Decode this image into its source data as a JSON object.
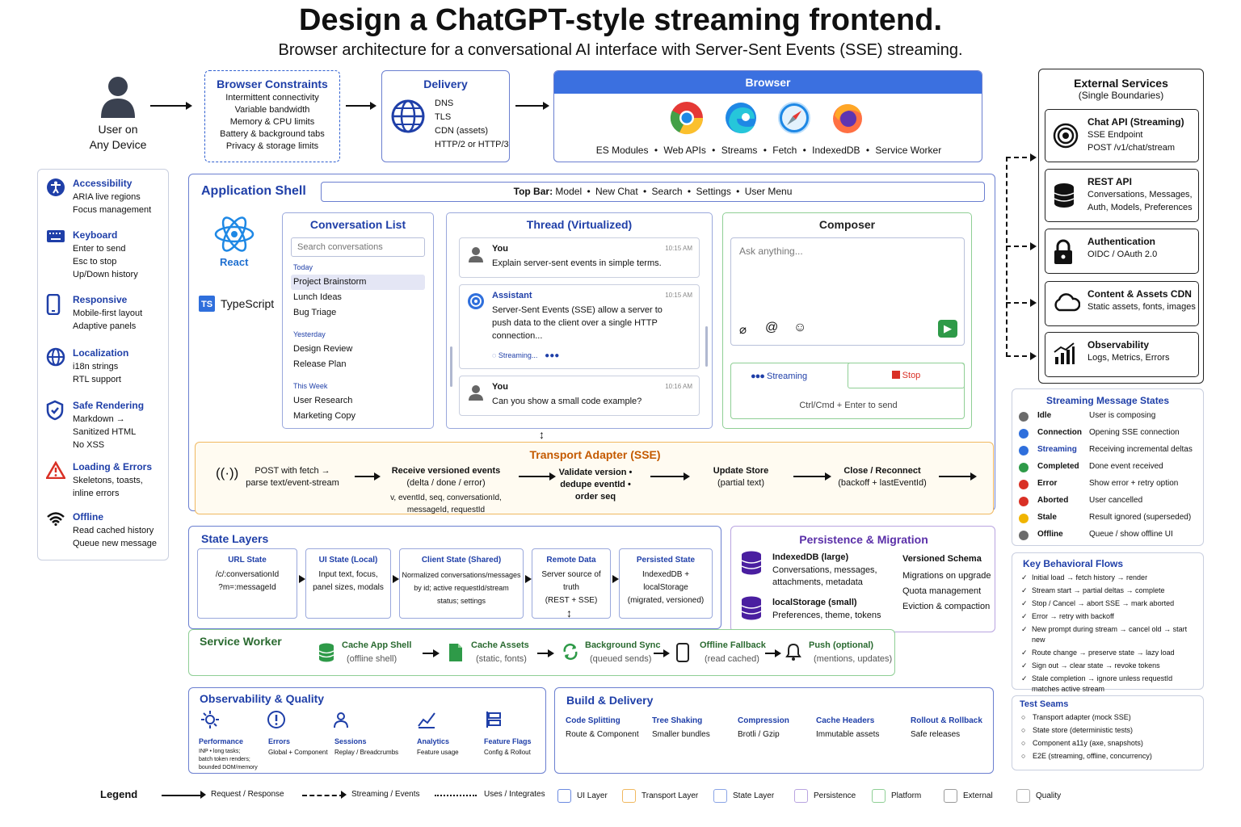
{
  "title": "Design a ChatGPT-style streaming frontend.",
  "subtitle": "Browser architecture for a conversational AI interface with Server-Sent Events (SSE) streaming.",
  "user": {
    "line1": "User on",
    "line2": "Any Device"
  },
  "constraints": {
    "title": "Browser Constraints",
    "items": [
      "Intermittent connectivity",
      "Variable bandwidth",
      "Memory & CPU limits",
      "Battery & background tabs",
      "Privacy & storage limits"
    ]
  },
  "delivery": {
    "title": "Delivery",
    "items": [
      "DNS",
      "TLS",
      "CDN (assets)",
      "HTTP/2 or HTTP/3"
    ]
  },
  "browser": {
    "title": "Browser",
    "features": [
      "ES Modules",
      "Web APIs",
      "Streams",
      "Fetch",
      "IndexedDB",
      "Service Worker"
    ]
  },
  "external": {
    "title": "External Services",
    "subtitle": "(Single Boundaries)",
    "services": [
      {
        "name": "Chat API (Streaming)",
        "lines": [
          "SSE Endpoint",
          "POST /v1/chat/stream"
        ],
        "icon": "sse-icon"
      },
      {
        "name": "REST API",
        "lines": [
          "Conversations, Messages,",
          "Auth, Models, Preferences"
        ],
        "icon": "database-icon"
      },
      {
        "name": "Authentication",
        "lines": [
          "OIDC / OAuth 2.0"
        ],
        "icon": "lock-icon"
      },
      {
        "name": "Content & Assets CDN",
        "lines": [
          "Static assets, fonts, images"
        ],
        "icon": "cloud-icon"
      },
      {
        "name": "Observability",
        "lines": [
          "Logs, Metrics, Errors"
        ],
        "icon": "chart-icon"
      }
    ]
  },
  "sidebar": [
    {
      "title": "Accessibility",
      "lines": [
        "ARIA live regions",
        "Focus management"
      ],
      "icon": "accessibility-icon"
    },
    {
      "title": "Keyboard",
      "lines": [
        "Enter to send",
        "Esc to stop",
        "Up/Down history"
      ],
      "icon": "keyboard-icon"
    },
    {
      "title": "Responsive",
      "lines": [
        "Mobile-first layout",
        "Adaptive panels"
      ],
      "icon": "mobile-icon"
    },
    {
      "title": "Localization",
      "lines": [
        "i18n strings",
        "RTL support"
      ],
      "icon": "globe-icon"
    },
    {
      "title": "Safe Rendering",
      "lines": [
        "Markdown →",
        "Sanitized HTML",
        "No XSS"
      ],
      "icon": "shield-icon"
    },
    {
      "title": "Loading & Errors",
      "lines": [
        "Skeletons, toasts,",
        "inline errors"
      ],
      "icon": "warning-icon"
    },
    {
      "title": "Offline",
      "lines": [
        "Read cached history",
        "Queue new message"
      ],
      "icon": "wifi-icon"
    }
  ],
  "shell": {
    "title": "Application Shell",
    "topbar_label": "Top Bar:",
    "topbar_items": [
      "Model",
      "New Chat",
      "Search",
      "Settings",
      "User Menu"
    ],
    "react": "React",
    "typescript": "TypeScript",
    "ts_badge": "TS"
  },
  "conversations": {
    "title": "Conversation List",
    "search_placeholder": "Search conversations",
    "groups": [
      {
        "label": "Today",
        "items": [
          "Project Brainstorm",
          "Lunch Ideas",
          "Bug Triage"
        ]
      },
      {
        "label": "Yesterday",
        "items": [
          "Design Review",
          "Release Plan"
        ]
      },
      {
        "label": "This Week",
        "items": [
          "User Research",
          "Marketing Copy"
        ]
      }
    ]
  },
  "thread": {
    "title": "Thread (Virtualized)",
    "messages": [
      {
        "author": "You",
        "time": "10:15 AM",
        "text": "Explain server-sent events in simple terms."
      },
      {
        "author": "Assistant",
        "time": "10:15 AM",
        "text": "Server-Sent Events (SSE) allow a server to push data to the client over a single HTTP connection...",
        "status": "Streaming..."
      },
      {
        "author": "You",
        "time": "10:16 AM",
        "text": "Can you show a small code example?"
      }
    ]
  },
  "composer": {
    "title": "Composer",
    "placeholder": "Ask anything...",
    "streaming": "Streaming",
    "stop": "Stop",
    "hint": "Ctrl/Cmd + Enter to send"
  },
  "transport": {
    "title": "Transport Adapter (SSE)",
    "steps": [
      {
        "main": "POST with fetch →",
        "sub": "parse text/event-stream"
      },
      {
        "main": "Receive versioned events",
        "sub": "(delta / done / error)",
        "extra": "v, eventId, seq, conversationId, messageId, requestId"
      },
      {
        "main": "Validate version • dedupe eventId • order seq",
        "sub": ""
      },
      {
        "main": "Update Store",
        "sub": "(partial text)"
      },
      {
        "main": "Close / Reconnect",
        "sub": "(backoff + lastEventId)"
      }
    ]
  },
  "state_layers": {
    "title": "State Layers",
    "items": [
      {
        "name": "URL State",
        "lines": [
          "/c/:conversationId",
          "?m=:messageId"
        ]
      },
      {
        "name": "UI State (Local)",
        "lines": [
          "Input text, focus,",
          "panel sizes, modals"
        ]
      },
      {
        "name": "Client State (Shared)",
        "lines": [
          "Normalized conversations/messages",
          "by id; active requestId/stream",
          "status; settings"
        ]
      },
      {
        "name": "Remote Data",
        "lines": [
          "Server source of truth",
          "(REST + SSE)"
        ]
      },
      {
        "name": "Persisted State",
        "lines": [
          "IndexedDB + localStorage",
          "(migrated, versioned)"
        ]
      }
    ]
  },
  "persistence": {
    "title": "Persistence & Migration",
    "stores": [
      {
        "name": "IndexedDB (large)",
        "lines": [
          "Conversations, messages,",
          "attachments, metadata"
        ]
      },
      {
        "name": "localStorage (small)",
        "lines": [
          "Preferences, theme, tokens"
        ]
      }
    ],
    "schema_title": "Versioned Schema",
    "schema_items": [
      "Migrations on upgrade",
      "Quota management",
      "Eviction & compaction"
    ]
  },
  "service_worker": {
    "title": "Service Worker",
    "steps": [
      {
        "name": "Cache App Shell",
        "sub": "(offline shell)"
      },
      {
        "name": "Cache Assets",
        "sub": "(static, fonts)"
      },
      {
        "name": "Background Sync",
        "sub": "(queued sends)"
      },
      {
        "name": "Offline Fallback",
        "sub": "(read cached)"
      },
      {
        "name": "Push (optional)",
        "sub": "(mentions, updates)"
      }
    ]
  },
  "observability": {
    "title": "Observability & Quality",
    "items": [
      {
        "name": "Performance",
        "lines": [
          "INP • long tasks;",
          "batch token renders;",
          "bounded DOM/memory"
        ]
      },
      {
        "name": "Errors",
        "lines": [
          "Global + Component"
        ]
      },
      {
        "name": "Sessions",
        "lines": [
          "Replay / Breadcrumbs"
        ]
      },
      {
        "name": "Analytics",
        "lines": [
          "Feature usage"
        ]
      },
      {
        "name": "Feature Flags",
        "lines": [
          "Config & Rollout"
        ]
      }
    ]
  },
  "build": {
    "title": "Build & Delivery",
    "items": [
      {
        "name": "Code Splitting",
        "sub": "Route & Component"
      },
      {
        "name": "Tree Shaking",
        "sub": "Smaller bundles"
      },
      {
        "name": "Compression",
        "sub": "Brotli / Gzip"
      },
      {
        "name": "Cache Headers",
        "sub": "Immutable assets"
      },
      {
        "name": "Rollout & Rollback",
        "sub": "Safe releases"
      }
    ]
  },
  "states": {
    "title": "Streaming Message States",
    "items": [
      {
        "name": "Idle",
        "desc": "User is composing",
        "color": "#6b6b6b"
      },
      {
        "name": "Connection",
        "desc": "Opening SSE connection",
        "color": "#2f6fdc"
      },
      {
        "name": "Streaming",
        "desc": "Receiving incremental deltas",
        "color": "#2f6fdc"
      },
      {
        "name": "Completed",
        "desc": "Done event received",
        "color": "#2e9a48"
      },
      {
        "name": "Error",
        "desc": "Show error + retry option",
        "color": "#d93025"
      },
      {
        "name": "Aborted",
        "desc": "User cancelled",
        "color": "#d93025"
      },
      {
        "name": "Stale",
        "desc": "Result ignored (superseded)",
        "color": "#f0b400"
      },
      {
        "name": "Offline",
        "desc": "Queue / show offline UI",
        "color": "#6b6b6b"
      }
    ]
  },
  "flows": {
    "title": "Key Behavioral Flows",
    "items": [
      "Initial load → fetch history → render",
      "Stream start → partial deltas → complete",
      "Stop / Cancel → abort SSE → mark aborted",
      "Error → retry with backoff",
      "New prompt during stream → cancel old → start new",
      "Route change → preserve state → lazy load",
      "Sign out → clear state → revoke tokens",
      "Stale completion → ignore unless requestId matches active stream"
    ]
  },
  "seams": {
    "title": "Test Seams",
    "items": [
      "Transport adapter (mock SSE)",
      "State store (deterministic tests)",
      "Component a11y (axe, snapshots)",
      "E2E (streaming, offline, concurrency)"
    ]
  },
  "legend": {
    "title": "Legend",
    "lines": [
      "Request / Response",
      "Streaming / Events",
      "Uses / Integrates"
    ],
    "layers": [
      {
        "name": "UI Layer",
        "color": "#6b8ae0"
      },
      {
        "name": "Transport Layer",
        "color": "#f0b860"
      },
      {
        "name": "State Layer",
        "color": "#8aa4e6"
      },
      {
        "name": "Persistence",
        "color": "#b9a4e0"
      },
      {
        "name": "Platform",
        "color": "#8fcf95"
      },
      {
        "name": "External",
        "color": "#9a9a9a"
      },
      {
        "name": "Quality",
        "color": "#b0b0b0"
      }
    ]
  }
}
